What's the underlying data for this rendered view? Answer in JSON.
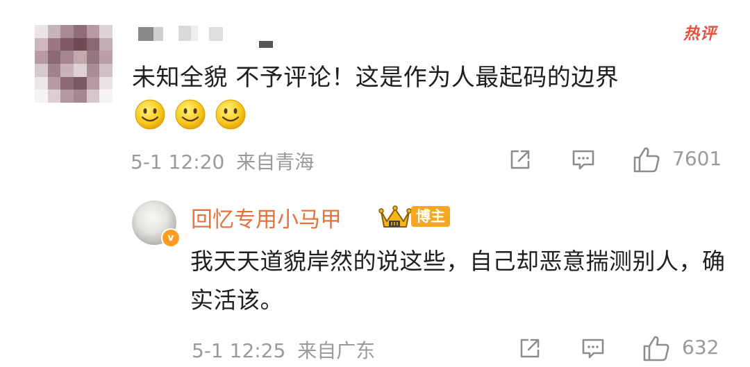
{
  "hot_comment": {
    "badge": "热评",
    "text": "未知全貌 不予评论！这是作为人最起码的边界",
    "emojis": [
      "smile-emoji",
      "smile-emoji",
      "smile-emoji"
    ],
    "time": "5-1 12:20",
    "location": "来自青海",
    "likes": "7601"
  },
  "reply": {
    "author": "回忆专用小马甲",
    "role_badge": "博主",
    "avatar_badge": "v",
    "text": "我天天道貌岸然的说这些，自己却恶意揣测别人，确实活该。",
    "time": "5-1 12:25",
    "location": "来自广东",
    "likes": "632"
  },
  "icons": [
    "share-icon",
    "comment-icon",
    "like-icon",
    "crown-icon"
  ],
  "colors": {
    "hot": "#e8513f",
    "author": "#e8713a",
    "badge": "#f5a623",
    "meta": "#9a9a9a"
  }
}
